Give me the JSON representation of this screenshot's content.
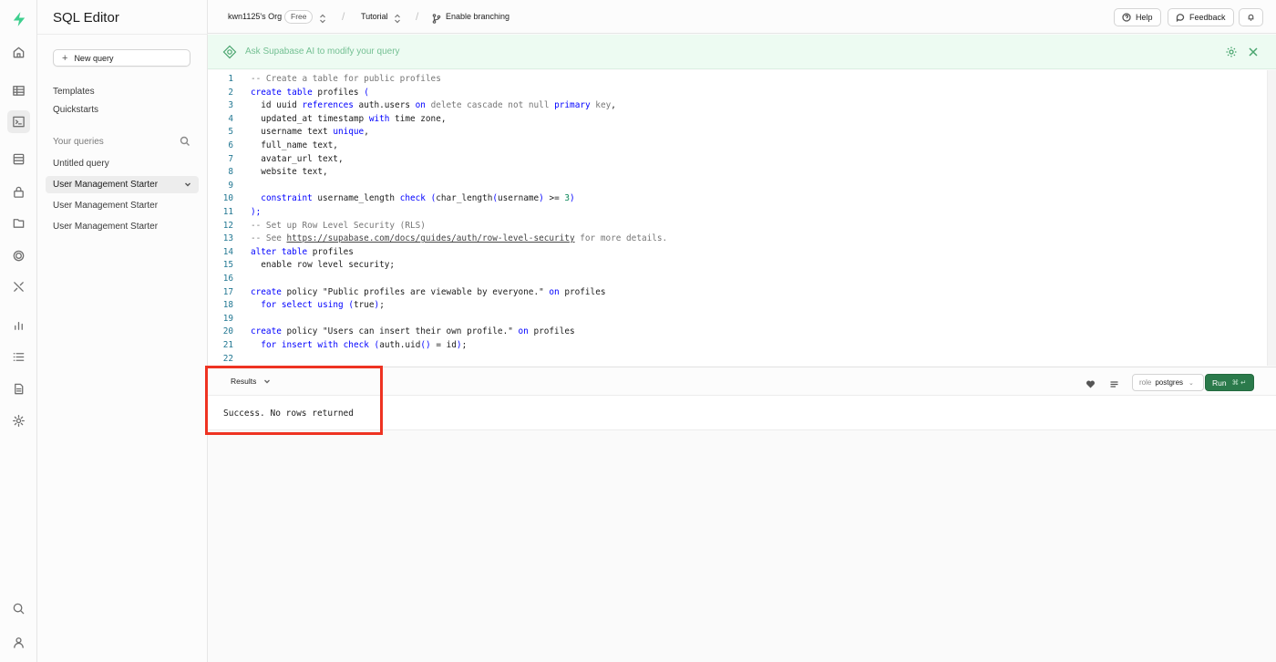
{
  "sidebar": {
    "title": "SQL Editor",
    "new_query": "New query",
    "links": [
      "Templates",
      "Quickstarts"
    ],
    "your_queries_label": "Your queries",
    "queries": [
      "Untitled query",
      "User Management Starter",
      "User Management Starter",
      "User Management Starter"
    ]
  },
  "topbar": {
    "org": "kwn1125's Org",
    "plan": "Free",
    "project": "Tutorial",
    "branching": "Enable branching",
    "help": "Help",
    "feedback": "Feedback"
  },
  "ai": {
    "placeholder": "Ask Supabase AI to modify your query"
  },
  "editor": {
    "line_numbers": [
      "1",
      "2",
      "3",
      "4",
      "5",
      "6",
      "7",
      "8",
      "9",
      "10",
      "11",
      "12",
      "13",
      "14",
      "15",
      "16",
      "17",
      "18",
      "19",
      "20",
      "21",
      "22"
    ],
    "lines": [
      "-- Create a table for public profiles",
      "create table profiles (",
      "  id uuid references auth.users on delete cascade not null primary key,",
      "  updated_at timestamp with time zone,",
      "  username text unique,",
      "  full_name text,",
      "  avatar_url text,",
      "  website text,",
      "",
      "  constraint username_length check (char_length(username) >= 3)",
      ");",
      "-- Set up Row Level Security (RLS)",
      "-- See https://supabase.com/docs/guides/auth/row-level-security for more details.",
      "alter table profiles",
      "  enable row level security;",
      "",
      "create policy \"Public profiles are viewable by everyone.\" on profiles",
      "  for select using (true);",
      "",
      "create policy \"Users can insert their own profile.\" on profiles",
      "  for insert with check (auth.uid() = id);",
      ""
    ]
  },
  "results": {
    "tab": "Results",
    "role_label": "role",
    "role_value": "postgres",
    "run": "Run",
    "run_shortcut": "⌘ ↵",
    "message": "Success. No rows returned"
  },
  "colors": {
    "brand": "#3ecf8e",
    "run_button": "#2b7a4b",
    "highlight": "#ee3322",
    "ai_bar": "#edfbf2"
  }
}
